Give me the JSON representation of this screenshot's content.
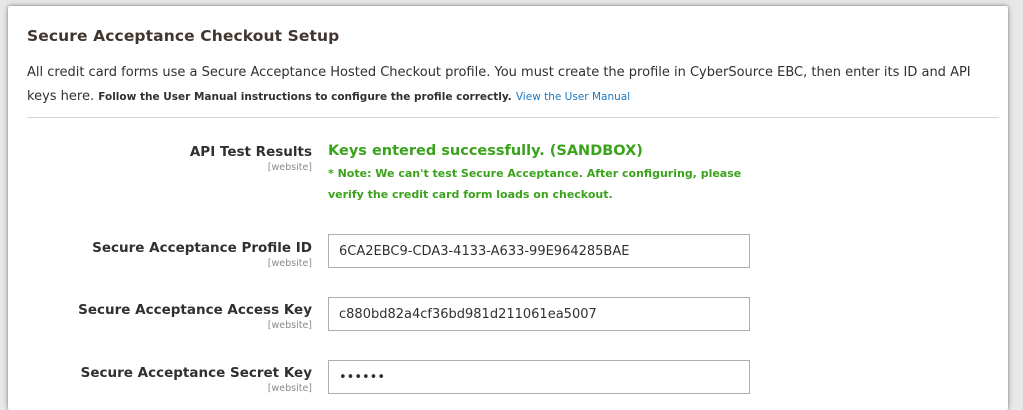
{
  "section": {
    "title": "Secure Acceptance Checkout Setup",
    "intro_text": "All credit card forms use a Secure Acceptance Hosted Checkout profile. You must create the profile in CyberSource EBC, then enter its ID and API keys here. ",
    "intro_strong": "Follow the User Manual instructions to configure the profile correctly.",
    "intro_link": "View the User Manual"
  },
  "fields": {
    "api_test": {
      "label": "API Test Results",
      "scope": "[website]",
      "status": "Keys entered successfully. (SANDBOX)",
      "note": "* Note: We can't test Secure Acceptance. After configuring, please verify the credit card form loads on checkout."
    },
    "profile_id": {
      "label": "Secure Acceptance Profile ID",
      "scope": "[website]",
      "value": "6CA2EBC9-CDA3-4133-A633-99E964285BAE"
    },
    "access_key": {
      "label": "Secure Acceptance Access Key",
      "scope": "[website]",
      "value": "c880bd82a4cf36bd981d211061ea5007"
    },
    "secret_key": {
      "label": "Secure Acceptance Secret Key",
      "scope": "[website]",
      "value": "••••••"
    }
  },
  "colors": {
    "success": "#3aa21b",
    "link": "#1979c3",
    "text": "#303030"
  }
}
